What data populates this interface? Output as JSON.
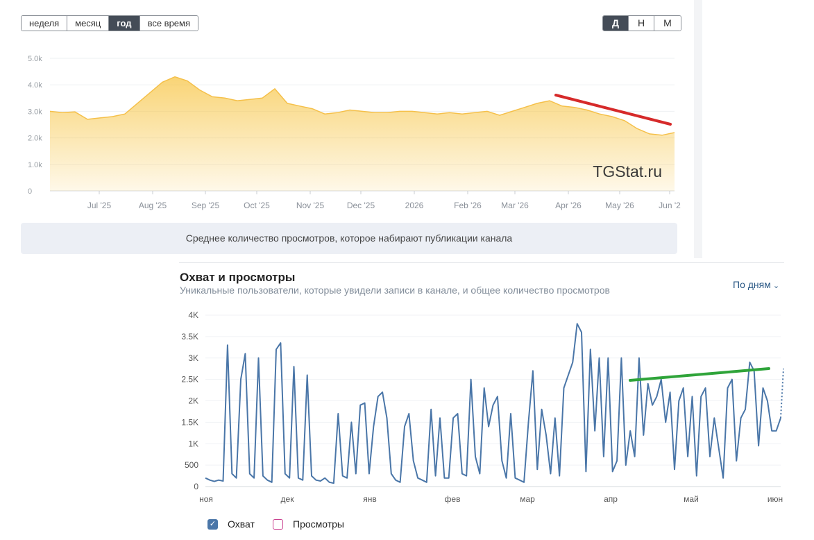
{
  "period_buttons": [
    {
      "label": "неделя",
      "active": false
    },
    {
      "label": "месяц",
      "active": false
    },
    {
      "label": "год",
      "active": true
    },
    {
      "label": "все время",
      "active": false
    }
  ],
  "scale_buttons": [
    {
      "label": "Д",
      "active": true
    },
    {
      "label": "Н",
      "active": false
    },
    {
      "label": "М",
      "active": false
    }
  ],
  "top_caption": "Среднее количество просмотров, которое набирают публикации канала",
  "watermark": "TGStat.ru",
  "bottom": {
    "title": "Охват и просмотры",
    "subtitle": "Уникальные пользователи, которые увидели записи в канале, и общее количество просмотров",
    "granularity": "По дням",
    "legend": [
      {
        "label": "Охват",
        "checked": true
      },
      {
        "label": "Просмотры",
        "checked": false
      }
    ]
  },
  "chart_data": [
    {
      "type": "area",
      "ylim": [
        0,
        5000
      ],
      "y_ticks": [
        "0",
        "1.0k",
        "2.0k",
        "3.0k",
        "4.0k",
        "5.0k"
      ],
      "x_ticks": [
        "Jul '25",
        "Aug '25",
        "Sep '25",
        "Oct '25",
        "Nov '25",
        "Dec '25",
        "2026",
        "Feb '26",
        "Mar '26",
        "Apr '26",
        "May '26",
        "Jun '2"
      ],
      "x": [
        0,
        2,
        4,
        6,
        8,
        10,
        12,
        14,
        16,
        18,
        20,
        22,
        24,
        26,
        28,
        30,
        32,
        34,
        36,
        38,
        40,
        42,
        44,
        46,
        48,
        50,
        52,
        54,
        56,
        58,
        60,
        62,
        64,
        66,
        68,
        70,
        72,
        74,
        76,
        78,
        80,
        82,
        84,
        86,
        88,
        90,
        92,
        94,
        96,
        98,
        100
      ],
      "values": [
        3000,
        2950,
        2980,
        2700,
        2750,
        2800,
        2900,
        3300,
        3700,
        4100,
        4300,
        4150,
        3800,
        3550,
        3500,
        3400,
        3450,
        3500,
        3850,
        3300,
        3200,
        3100,
        2900,
        2950,
        3050,
        3000,
        2950,
        2950,
        3000,
        3000,
        2950,
        2900,
        2950,
        2900,
        2950,
        3000,
        2850,
        3000,
        3150,
        3300,
        3400,
        3200,
        3150,
        3050,
        2900,
        2800,
        2650,
        2350,
        2150,
        2100,
        2200
      ],
      "color": "#f7c648",
      "annotation_color": "#d62a2a"
    },
    {
      "type": "line",
      "series": [
        {
          "name": "Охват",
          "color": "#4a76a8"
        }
      ],
      "ylim": [
        0,
        4000
      ],
      "y_ticks": [
        "0",
        "500",
        "1K",
        "1.5K",
        "2K",
        "2.5K",
        "3K",
        "3.5K",
        "4K"
      ],
      "x_ticks": [
        "ноя",
        "дек",
        "янв",
        "фев",
        "мар",
        "апр",
        "май",
        "июн"
      ],
      "values": [
        200,
        150,
        120,
        150,
        130,
        3300,
        300,
        200,
        2500,
        3100,
        300,
        200,
        3000,
        250,
        150,
        100,
        3200,
        3350,
        300,
        200,
        2800,
        200,
        150,
        2600,
        250,
        150,
        130,
        200,
        100,
        80,
        1700,
        250,
        200,
        1500,
        300,
        1900,
        1950,
        300,
        1400,
        2100,
        2200,
        1600,
        300,
        150,
        100,
        1400,
        1700,
        600,
        200,
        150,
        100,
        1800,
        250,
        1600,
        200,
        200,
        1600,
        1700,
        300,
        250,
        2500,
        700,
        300,
        2300,
        1400,
        1900,
        2100,
        600,
        200,
        1700,
        200,
        150,
        100,
        1500,
        2700,
        400,
        1800,
        1200,
        300,
        1600,
        250,
        2300,
        2600,
        2900,
        3800,
        3600,
        350,
        3200,
        1300,
        3000,
        700,
        3000,
        350,
        600,
        3000,
        500,
        1300,
        700,
        3000,
        1200,
        2400,
        1900,
        2100,
        2500,
        1500,
        2200,
        400,
        2000,
        2300,
        700,
        2100,
        250,
        2100,
        2300,
        700,
        1600,
        900,
        200,
        2300,
        2500,
        600,
        1600,
        1800,
        2900,
        2700,
        950,
        2300,
        2000,
        1300,
        1300,
        1600
      ],
      "annotation_color": "#2fa43a"
    }
  ]
}
